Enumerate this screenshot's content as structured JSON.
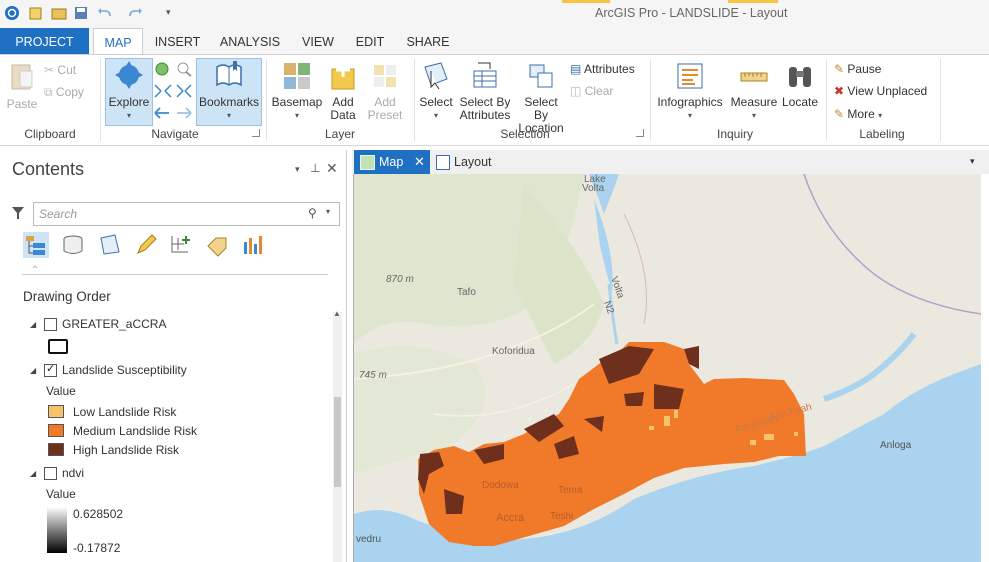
{
  "window": {
    "title": "ArcGIS Pro - LANDSLIDE - Layout"
  },
  "tabs": {
    "project": "PROJECT",
    "map": "MAP",
    "insert": "INSERT",
    "analysis": "ANALYSIS",
    "view": "VIEW",
    "edit": "EDIT",
    "share": "SHARE"
  },
  "ribbon": {
    "clipboard": {
      "paste": "Paste",
      "cut": "Cut",
      "copy": "Copy",
      "group": "Clipboard"
    },
    "navigate": {
      "explore": "Explore",
      "bookmarks": "Bookmarks",
      "group": "Navigate"
    },
    "layer": {
      "basemap": "Basemap",
      "add_data_1": "Add",
      "add_data_2": "Data",
      "add_preset_1": "Add",
      "add_preset_2": "Preset",
      "group": "Layer"
    },
    "selection": {
      "select": "Select",
      "by_attr_1": "Select By",
      "by_attr_2": "Attributes",
      "by_loc_1": "Select By",
      "by_loc_2": "Location",
      "attributes": "Attributes",
      "clear": "Clear",
      "group": "Selection"
    },
    "inquiry": {
      "infographics": "Infographics",
      "measure": "Measure",
      "locate": "Locate",
      "group": "Inquiry"
    },
    "labeling": {
      "pause": "Pause",
      "view_unplaced": "View Unplaced",
      "more": "More",
      "group": "Labeling"
    }
  },
  "contents": {
    "title": "Contents",
    "search_placeholder": "Search",
    "drawing_order": "Drawing Order",
    "layers": [
      {
        "name": "GREATER_aCCRA",
        "checked": false
      },
      {
        "name": "Landslide Susceptibility",
        "checked": true,
        "value_label": "Value",
        "legend": [
          {
            "label": "Low Landslide Risk",
            "color": "#f5c36a"
          },
          {
            "label": "Medium Landslide Risk",
            "color": "#f07a2a"
          },
          {
            "label": "High Landslide Risk",
            "color": "#6e2f1d"
          }
        ]
      },
      {
        "name": "ndvi",
        "checked": false,
        "value_label": "Value",
        "max": "0.628502",
        "min": "-0.17872"
      }
    ]
  },
  "view_tabs": {
    "map": "Map",
    "layout": "Layout"
  },
  "map_labels": {
    "lake_volta_1": "Lake",
    "lake_volta_2": "Volta",
    "elev_870": "870 m",
    "tafo": "Tafo",
    "koforidua": "Koforidua",
    "elev_745": "745 m",
    "volta": "Volta",
    "n2": "N2",
    "anloga": "Anloga",
    "accra": "Accra",
    "tema": "Tema",
    "teshi": "Teshi",
    "dodowa": "Dodowa",
    "vedru": "vedru",
    "ashaiman": "Ashaiman",
    "ada": "Ada Foah"
  },
  "colors": {
    "accent": "#1f6fc3",
    "low": "#f5c36a",
    "medium": "#f07a2a",
    "high": "#6e2f1d",
    "water": "#a9d3ee"
  }
}
